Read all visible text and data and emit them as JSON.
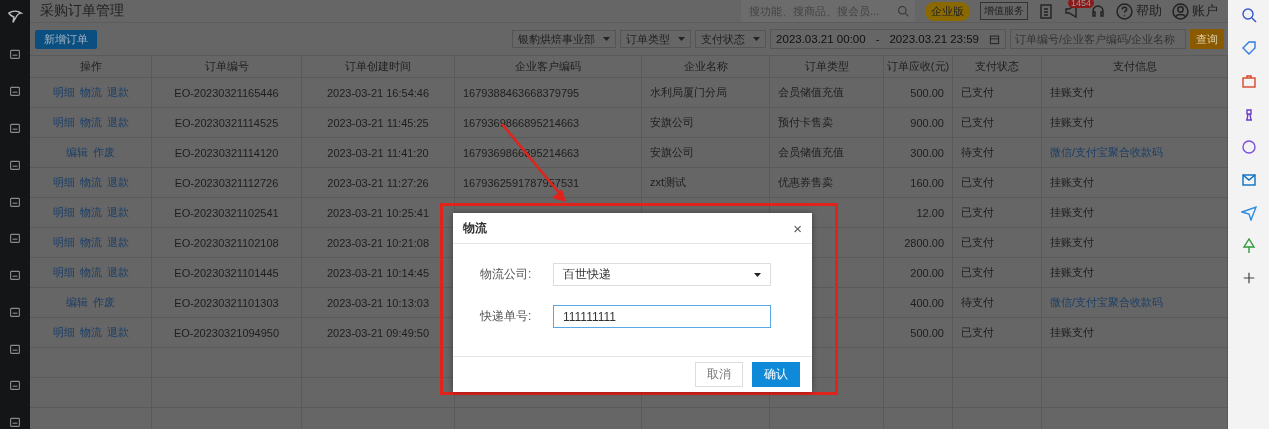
{
  "header": {
    "title": "采购订单管理",
    "search": {
      "placeholder": "搜功能、搜商品、搜会员..."
    },
    "edition_badge": "企业版",
    "value_service": "增值服务",
    "notification_count": "1454",
    "help": "帮助",
    "account": "账户"
  },
  "toolbar": {
    "new_order": "新增订单",
    "filters": [
      {
        "label": "银豹烘焙事业部"
      },
      {
        "label": "订单类型"
      },
      {
        "label": "支付状态"
      }
    ],
    "date_start": "2023.03.21 00:00",
    "date_sep": "-",
    "date_end": "2023.03.21 23:59",
    "search": {
      "placeholder": "订单编号/企业客户编码/企业名称"
    },
    "query": "查询"
  },
  "table": {
    "columns": [
      "操作",
      "订单编号",
      "订单创建时间",
      "企业客户编码",
      "企业名称",
      "订单类型",
      "订单应收(元)",
      "支付状态",
      "支付信息"
    ],
    "rows": [
      {
        "actions": [
          "明细",
          "物流",
          "退款"
        ],
        "order_no": "EO-20230321165446",
        "created": "2023-03-21 16:54:46",
        "customer_code": "1679388463668379795",
        "company": "水利局厦门分局",
        "order_type": "会员储值充值",
        "amount": "500.00",
        "status": "已支付",
        "payment": {
          "kind": "text",
          "text": "挂账支付"
        }
      },
      {
        "actions": [
          "明细",
          "物流",
          "退款"
        ],
        "order_no": "EO-20230321114525",
        "created": "2023-03-21 11:45:25",
        "customer_code": "1679369866895214663",
        "company": "安旗公司",
        "order_type": "预付卡售卖",
        "amount": "900.00",
        "status": "已支付",
        "payment": {
          "kind": "text",
          "text": "挂账支付"
        }
      },
      {
        "actions": [
          "编辑",
          "作废"
        ],
        "order_no": "EO-20230321114120",
        "created": "2023-03-21 11:41:20",
        "customer_code": "1679369866895214663",
        "company": "安旗公司",
        "order_type": "会员储值充值",
        "amount": "300.00",
        "status": "待支付",
        "payment": {
          "kind": "link",
          "text": "微信/支付宝聚合收款码"
        }
      },
      {
        "actions": [
          "明细",
          "物流",
          "退款"
        ],
        "order_no": "EO-20230321112726",
        "created": "2023-03-21 11:27:26",
        "customer_code": "1679362591787957531",
        "company": "zxt测试",
        "order_type": "优惠券售卖",
        "amount": "160.00",
        "status": "已支付",
        "payment": {
          "kind": "text",
          "text": "挂账支付"
        }
      },
      {
        "actions": [
          "明细",
          "物流",
          "退款"
        ],
        "order_no": "EO-20230321102541",
        "created": "2023-03-21 10:25:41",
        "amount": "12.00",
        "status": "已支付",
        "payment": {
          "kind": "text",
          "text": "挂账支付"
        }
      },
      {
        "actions": [
          "明细",
          "物流",
          "退款"
        ],
        "order_no": "EO-20230321102108",
        "created": "2023-03-21 10:21:08",
        "amount": "2800.00",
        "status": "已支付",
        "payment": {
          "kind": "text",
          "text": "挂账支付"
        }
      },
      {
        "actions": [
          "明细",
          "物流",
          "退款"
        ],
        "order_no": "EO-20230321101445",
        "created": "2023-03-21 10:14:45",
        "amount": "200.00",
        "status": "已支付",
        "payment": {
          "kind": "text",
          "text": "挂账支付"
        }
      },
      {
        "actions": [
          "编辑",
          "作废"
        ],
        "order_no": "EO-20230321101303",
        "created": "2023-03-21 10:13:03",
        "amount": "400.00",
        "status": "待支付",
        "payment": {
          "kind": "link",
          "text": "微信/支付宝聚合收款码"
        }
      },
      {
        "actions": [
          "明细",
          "物流",
          "退款"
        ],
        "order_no": "EO-20230321094950",
        "created": "2023-03-21 09:49:50",
        "amount": "500.00",
        "status": "已支付",
        "payment": {
          "kind": "text",
          "text": "挂账支付"
        }
      }
    ]
  },
  "dialog": {
    "title": "物流",
    "close": "×",
    "fields": [
      {
        "kind": "select",
        "label": "物流公司:",
        "value": "百世快递",
        "focused": false
      },
      {
        "kind": "input",
        "label": "快递单号:",
        "value": "111111111",
        "focused": true
      }
    ],
    "buttons": [
      {
        "label": "取消",
        "primary": false
      },
      {
        "label": "确认",
        "primary": true
      }
    ]
  }
}
